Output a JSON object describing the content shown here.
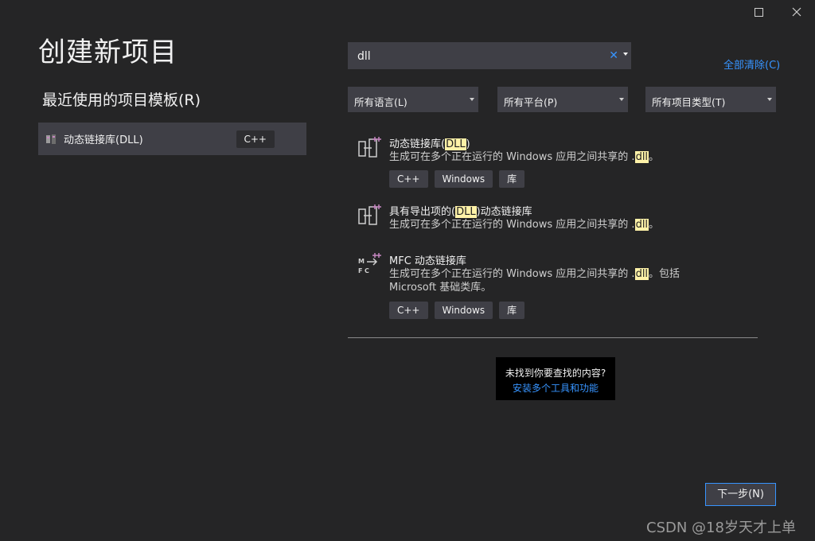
{
  "window": {
    "maximize_icon": "maximize-icon",
    "close_icon": "close-icon"
  },
  "title": "创建新项目",
  "recent": {
    "heading": "最近使用的项目模板(R)",
    "items": [
      {
        "label": "动态链接库(DLL)",
        "tag": "C++",
        "icon": "dll-project-icon"
      }
    ]
  },
  "search": {
    "value": "dll",
    "clear_glyph": "✕",
    "placeholder": ""
  },
  "clear_all": "全部清除(C)",
  "filters": {
    "language": "所有语言(L)",
    "platform": "所有平台(P)",
    "project_type": "所有项目类型(T)"
  },
  "results": [
    {
      "name_pre": "动态链接库(",
      "name_hl": "DLL",
      "name_post": ")",
      "desc_pre": "生成可在多个正在运行的 Windows 应用之间共享的 .",
      "desc_hl": "dll",
      "desc_post": "。",
      "tags": [
        "C++",
        "Windows",
        "库"
      ],
      "icon": "dll-project-icon"
    },
    {
      "name_pre": "具有导出项的(",
      "name_hl": "DLL",
      "name_post": ")动态链接库",
      "desc_pre": "生成可在多个正在运行的 Windows 应用之间共享的 .",
      "desc_hl": "dll",
      "desc_post": "。",
      "tags": [],
      "icon": "dll-export-project-icon"
    },
    {
      "name_pre": "MFC 动态链接库",
      "name_hl": "",
      "name_post": "",
      "desc_pre": "生成可在多个正在运行的 Windows 应用之间共享的 .",
      "desc_hl": "dll",
      "desc_post": "。包括",
      "desc_line2": "Microsoft 基础类库。",
      "tags": [
        "C++",
        "Windows",
        "库"
      ],
      "icon": "mfc-dll-project-icon"
    }
  ],
  "not_found": {
    "question": "未找到你要查找的内容?",
    "link": "安装多个工具和功能"
  },
  "next_button": "下一步(N)",
  "watermark": "CSDN @18岁天才上单",
  "colors": {
    "background": "#252526",
    "panel": "#3f3f46",
    "accent": "#3794ff",
    "highlight": "#fff2a8"
  }
}
